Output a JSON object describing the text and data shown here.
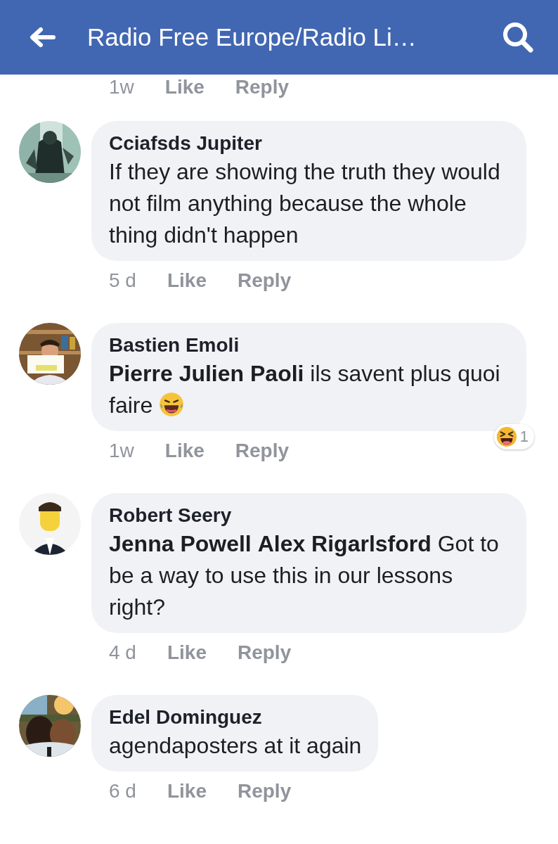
{
  "header": {
    "title": "Radio Free Europe/Radio Li…"
  },
  "previous_meta": {
    "time": "1w",
    "like": "Like",
    "reply": "Reply"
  },
  "comments": [
    {
      "author": "Cciafsds Jupiter",
      "text": "If they are showing the truth they would not film anything because the whole thing didn't happen",
      "emoji": false,
      "time": "5 d",
      "like": "Like",
      "reply": "Reply"
    },
    {
      "author": "Bastien Emoli",
      "text": "**Pierre Julien Paoli** ils savent plus quoi faire",
      "emoji": true,
      "time": "1w",
      "like": "Like",
      "reply": "Reply",
      "reaction": {
        "kind": "laughing",
        "count": "1"
      }
    },
    {
      "author": "Robert Seery",
      "text": "**Jenna Powell** **Alex Rigarlsford** Got to be a way to use this in our lessons right?",
      "emoji": false,
      "time": "4 d",
      "like": "Like",
      "reply": "Reply"
    },
    {
      "author": "Edel Dominguez",
      "text": "agendaposters at it again",
      "emoji": false,
      "time": "6 d",
      "like": "Like",
      "reply": "Reply"
    }
  ]
}
